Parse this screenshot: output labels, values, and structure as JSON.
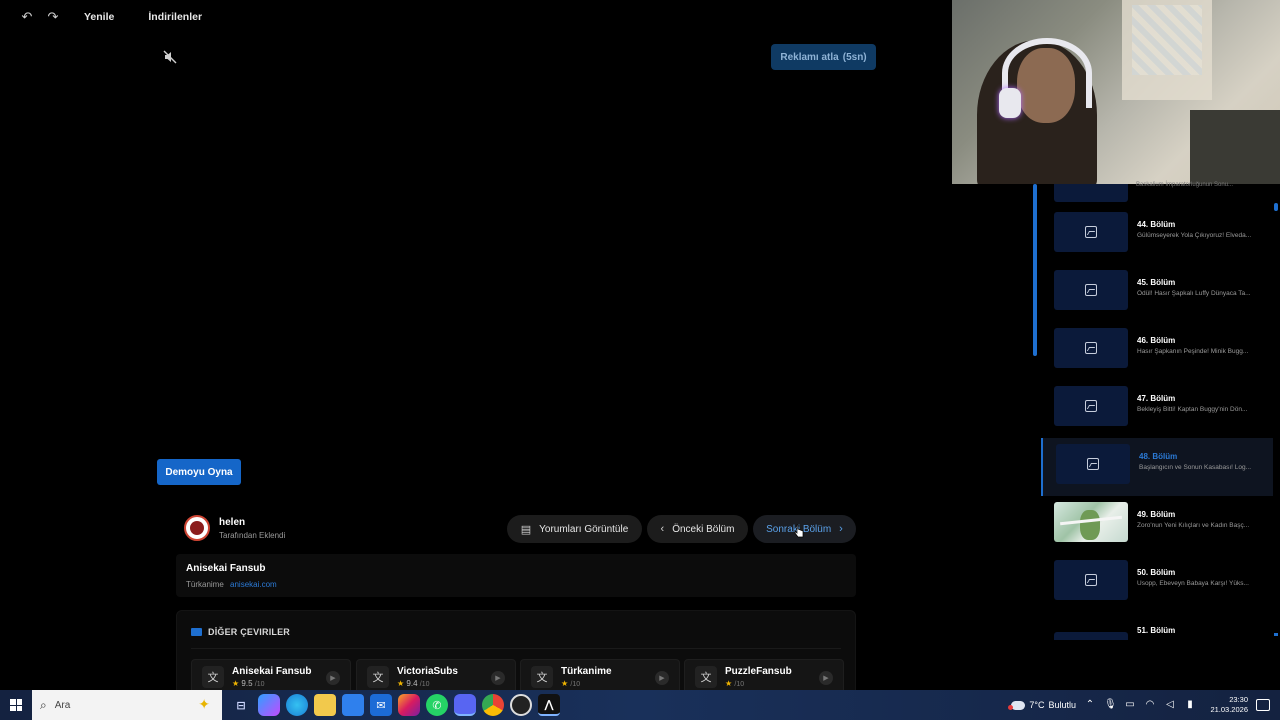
{
  "toolbar": {
    "back_icon": "undo-icon",
    "forward_icon": "redo-icon",
    "refresh_label": "Yenile",
    "downloads_label": "İndirilenler"
  },
  "player": {
    "mute_icon": "muted-speaker-icon",
    "skip_ad_label": "Reklamı atla",
    "skip_ad_countdown": "(5sn)",
    "demo_button_label": "Demoyu Oyna"
  },
  "uploader": {
    "name": "helen",
    "subtitle": "Tarafından Eklendi"
  },
  "actions": {
    "comments_label": "Yorumları Görüntüle",
    "prev_label": "Önceki Bölüm",
    "next_label": "Sonraki Bölüm"
  },
  "fansub": {
    "name": "Anisekai Fansub",
    "source": "Türkanime",
    "link": "anisekai.com"
  },
  "other_translations": {
    "title": "DİĞER ÇEVIRILER",
    "items": [
      {
        "name": "Anisekai Fansub",
        "rating": "9.5",
        "scale": "/10"
      },
      {
        "name": "VictoriaSubs",
        "rating": "9.4",
        "scale": "/10"
      },
      {
        "name": "Türkanime",
        "rating": "",
        "scale": "/10"
      },
      {
        "name": "PuzzleFansub",
        "rating": "",
        "scale": "/10"
      }
    ]
  },
  "episodes": {
    "partial_top_text": "Baskalium İmparatorluğunun Sonu...",
    "items": [
      {
        "title": "44. Bölüm",
        "subtitle": "Gülümseyerek Yola Çıkıyoruz! Elveda..."
      },
      {
        "title": "45. Bölüm",
        "subtitle": "Ödül! Hasır Şapkalı Luffy Dünyaca Ta..."
      },
      {
        "title": "46. Bölüm",
        "subtitle": "Hasır Şapkanın Peşinde! Minik Bugg..."
      },
      {
        "title": "47. Bölüm",
        "subtitle": "Bekleyiş Bitti! Kaptan Buggy'nin Dön..."
      },
      {
        "title": "48. Bölüm",
        "subtitle": "Başlangıcın ve Sonun Kasabası! Log..."
      },
      {
        "title": "49. Bölüm",
        "subtitle": "Zoro'nun Yeni Kılıçları ve Kadın Başç..."
      },
      {
        "title": "50. Bölüm",
        "subtitle": "Usopp, Ebeveyn Babaya Karşı! Yüks..."
      },
      {
        "title": "51. Bölüm",
        "subtitle": ""
      }
    ],
    "active_index": 4
  },
  "taskbar": {
    "search_placeholder": "Ara",
    "weather_temp": "7°C",
    "weather_desc": "Bulutlu",
    "time": "23:30",
    "date": "21.03.2026",
    "apps": [
      "task-view-icon",
      "copilot-icon",
      "edge-icon",
      "file-explorer-icon",
      "store-icon",
      "mail-icon",
      "instagram-icon",
      "whatsapp-icon",
      "discord-icon",
      "chrome-icon",
      "obs-icon",
      "app-icon"
    ]
  },
  "colors": {
    "accent": "#1e6fd0",
    "link": "#2b7ad6",
    "skip_ad_bg": "#0f3a63",
    "demo_bg": "#1566c8",
    "star": "#f0b400"
  }
}
